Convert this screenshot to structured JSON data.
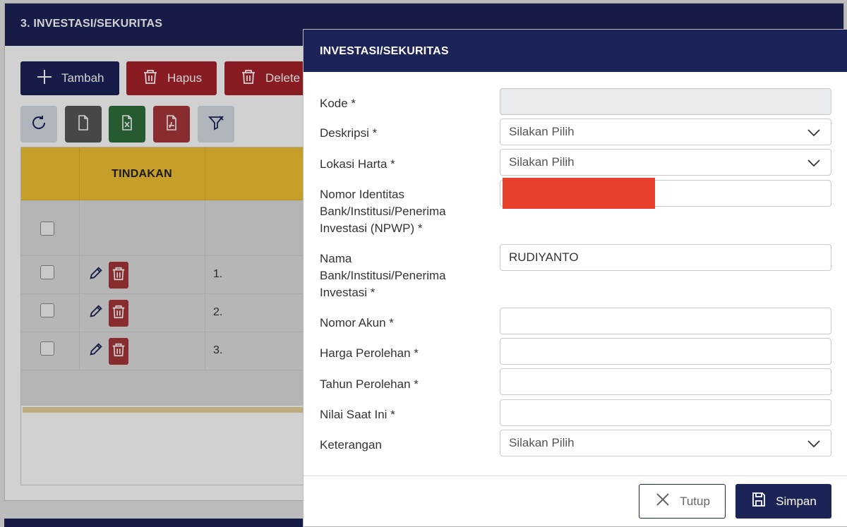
{
  "section": {
    "title": "3. INVESTASI/SEKURITAS"
  },
  "toolbar": {
    "tambah_label": "Tambah",
    "hapus_label": "Hapus",
    "delete_all_label": "Delete A"
  },
  "icon_buttons": [
    "refresh-icon",
    "document-icon",
    "excel-icon",
    "pdf-icon",
    "filter-icon"
  ],
  "table": {
    "header_tindakan": "TINDAKAN",
    "rows": [
      {
        "no": "1."
      },
      {
        "no": "2."
      },
      {
        "no": "3."
      }
    ]
  },
  "modal": {
    "title": "INVESTASI/SEKURITAS",
    "fields": {
      "kode": {
        "label": "Kode *",
        "value": ""
      },
      "deskripsi": {
        "label": "Deskripsi *",
        "value": "Silakan Pilih"
      },
      "lokasi_harta": {
        "label": "Lokasi Harta *",
        "value": "Silakan Pilih"
      },
      "nomor_identitas": {
        "label_line1": "Nomor Identitas",
        "label_line2": "Bank/Institusi/Penerima",
        "label_line3": "Investasi (NPWP) *",
        "value": ""
      },
      "nama": {
        "label_line1": "Nama",
        "label_line2": "Bank/Institusi/Penerima",
        "label_line3": "Investasi *",
        "value": "RUDIYANTO"
      },
      "nomor_akun": {
        "label": "Nomor Akun *",
        "value": ""
      },
      "harga_perolehan": {
        "label": "Harga Perolehan *",
        "value": ""
      },
      "tahun_perolehan": {
        "label": "Tahun Perolehan *",
        "value": ""
      },
      "nilai_saat_ini": {
        "label": "Nilai Saat Ini *",
        "value": ""
      },
      "keterangan": {
        "label": "Keterangan",
        "value": "Silakan Pilih"
      }
    },
    "buttons": {
      "tutup": "Tutup",
      "simpan": "Simpan"
    }
  },
  "colors": {
    "navy": "#1c2357",
    "danger": "#a6232a",
    "table_header": "#f1c232",
    "redaction": "#e8412c"
  }
}
